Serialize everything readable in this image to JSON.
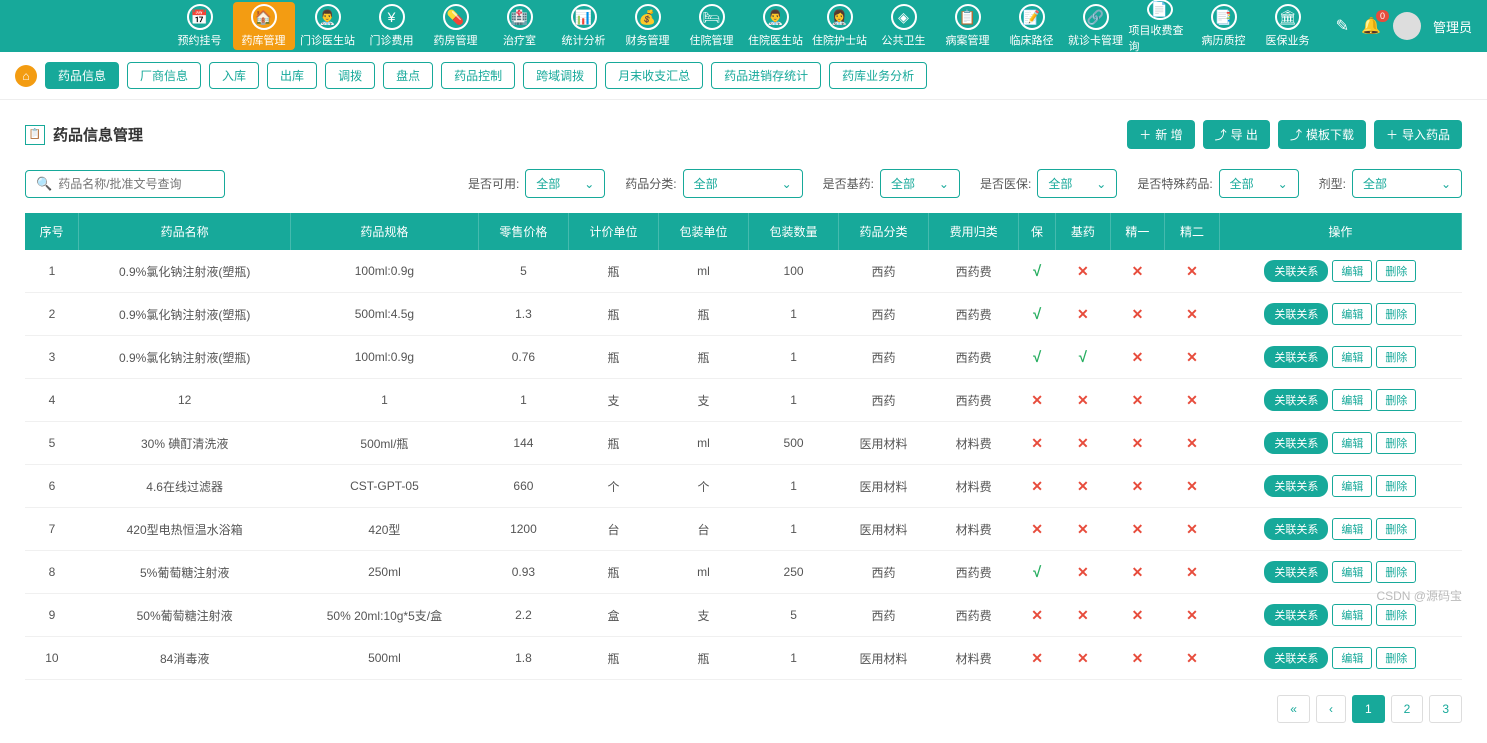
{
  "topNav": {
    "items": [
      {
        "icon": "📅",
        "label": "预约挂号"
      },
      {
        "icon": "🏠",
        "label": "药库管理",
        "active": true
      },
      {
        "icon": "👨‍⚕",
        "label": "门诊医生站"
      },
      {
        "icon": "¥",
        "label": "门诊费用"
      },
      {
        "icon": "💊",
        "label": "药房管理"
      },
      {
        "icon": "🏥",
        "label": "治疗室"
      },
      {
        "icon": "📊",
        "label": "统计分析"
      },
      {
        "icon": "💰",
        "label": "财务管理"
      },
      {
        "icon": "🛏",
        "label": "住院管理"
      },
      {
        "icon": "👨‍⚕",
        "label": "住院医生站"
      },
      {
        "icon": "👩‍⚕",
        "label": "住院护士站"
      },
      {
        "icon": "◈",
        "label": "公共卫生"
      },
      {
        "icon": "📋",
        "label": "病案管理"
      },
      {
        "icon": "📝",
        "label": "临床路径"
      },
      {
        "icon": "🔗",
        "label": "就诊卡管理"
      },
      {
        "icon": "📄",
        "label": "项目收费查询"
      },
      {
        "icon": "📑",
        "label": "病历质控"
      },
      {
        "icon": "🏛",
        "label": "医保业务"
      }
    ],
    "badgeCount": "0",
    "username": "管理员"
  },
  "subNav": {
    "tabs": [
      {
        "label": "药品信息",
        "active": true
      },
      {
        "label": "厂商信息"
      },
      {
        "label": "入库"
      },
      {
        "label": "出库"
      },
      {
        "label": "调拨"
      },
      {
        "label": "盘点"
      },
      {
        "label": "药品控制"
      },
      {
        "label": "跨域调拨"
      },
      {
        "label": "月末收支汇总"
      },
      {
        "label": "药品进销存统计"
      },
      {
        "label": "药库业务分析"
      }
    ]
  },
  "page": {
    "title": "药品信息管理",
    "actions": {
      "add": "新 增",
      "export": "导 出",
      "template": "模板下载",
      "import": "导入药品"
    }
  },
  "filters": {
    "searchPlaceholder": "药品名称/批准文号查询",
    "items": [
      {
        "label": "是否可用:",
        "value": "全部"
      },
      {
        "label": "药品分类:",
        "value": "全部",
        "wide": true
      },
      {
        "label": "是否基药:",
        "value": "全部"
      },
      {
        "label": "是否医保:",
        "value": "全部"
      },
      {
        "label": "是否特殊药品:",
        "value": "全部"
      },
      {
        "label": "剂型:",
        "value": "全部",
        "xwide": true
      }
    ]
  },
  "table": {
    "headers": [
      "序号",
      "药品名称",
      "药品规格",
      "零售价格",
      "计价单位",
      "包装单位",
      "包装数量",
      "药品分类",
      "费用归类",
      "保",
      "基药",
      "精一",
      "精二",
      "操作"
    ],
    "actionLabels": {
      "relate": "关联关系",
      "edit": "编辑",
      "del": "删除"
    },
    "rows": [
      {
        "no": "1",
        "name": "0.9%氯化钠注射液(塑瓶)",
        "spec": "100ml:0.9g",
        "price": "5",
        "unit": "瓶",
        "pkgUnit": "ml",
        "pkgQty": "100",
        "cat": "西药",
        "feeCat": "西药费",
        "bao": true,
        "ji": false,
        "j1": false,
        "j2": false
      },
      {
        "no": "2",
        "name": "0.9%氯化钠注射液(塑瓶)",
        "spec": "500ml:4.5g",
        "price": "1.3",
        "unit": "瓶",
        "pkgUnit": "瓶",
        "pkgQty": "1",
        "cat": "西药",
        "feeCat": "西药费",
        "bao": true,
        "ji": false,
        "j1": false,
        "j2": false
      },
      {
        "no": "3",
        "name": "0.9%氯化钠注射液(塑瓶)",
        "spec": "100ml:0.9g",
        "price": "0.76",
        "unit": "瓶",
        "pkgUnit": "瓶",
        "pkgQty": "1",
        "cat": "西药",
        "feeCat": "西药费",
        "bao": true,
        "ji": true,
        "j1": false,
        "j2": false
      },
      {
        "no": "4",
        "name": "12",
        "spec": "1",
        "price": "1",
        "unit": "支",
        "pkgUnit": "支",
        "pkgQty": "1",
        "cat": "西药",
        "feeCat": "西药费",
        "bao": false,
        "ji": false,
        "j1": false,
        "j2": false
      },
      {
        "no": "5",
        "name": "30% 碘酊清洗液",
        "spec": "500ml/瓶",
        "price": "144",
        "unit": "瓶",
        "pkgUnit": "ml",
        "pkgQty": "500",
        "cat": "医用材料",
        "feeCat": "材料费",
        "bao": false,
        "ji": false,
        "j1": false,
        "j2": false
      },
      {
        "no": "6",
        "name": "4.6在线过滤器",
        "spec": "CST-GPT-05",
        "price": "660",
        "unit": "个",
        "pkgUnit": "个",
        "pkgQty": "1",
        "cat": "医用材料",
        "feeCat": "材料费",
        "bao": false,
        "ji": false,
        "j1": false,
        "j2": false
      },
      {
        "no": "7",
        "name": "420型电热恒温水浴箱",
        "spec": "420型",
        "price": "1200",
        "unit": "台",
        "pkgUnit": "台",
        "pkgQty": "1",
        "cat": "医用材料",
        "feeCat": "材料费",
        "bao": false,
        "ji": false,
        "j1": false,
        "j2": false
      },
      {
        "no": "8",
        "name": "5%葡萄糖注射液",
        "spec": "250ml",
        "price": "0.93",
        "unit": "瓶",
        "pkgUnit": "ml",
        "pkgQty": "250",
        "cat": "西药",
        "feeCat": "西药费",
        "bao": true,
        "ji": false,
        "j1": false,
        "j2": false
      },
      {
        "no": "9",
        "name": "50%葡萄糖注射液",
        "spec": "50% 20ml:10g*5支/盒",
        "price": "2.2",
        "unit": "盒",
        "pkgUnit": "支",
        "pkgQty": "5",
        "cat": "西药",
        "feeCat": "西药费",
        "bao": false,
        "ji": false,
        "j1": false,
        "j2": false
      },
      {
        "no": "10",
        "name": "84消毒液",
        "spec": "500ml",
        "price": "1.8",
        "unit": "瓶",
        "pkgUnit": "瓶",
        "pkgQty": "1",
        "cat": "医用材料",
        "feeCat": "材料费",
        "bao": false,
        "ji": false,
        "j1": false,
        "j2": false
      }
    ]
  },
  "pagination": {
    "first": "«",
    "prev": "‹",
    "pages": [
      "1",
      "2",
      "3"
    ],
    "active": "1"
  },
  "watermark": "CSDN @源码宝"
}
